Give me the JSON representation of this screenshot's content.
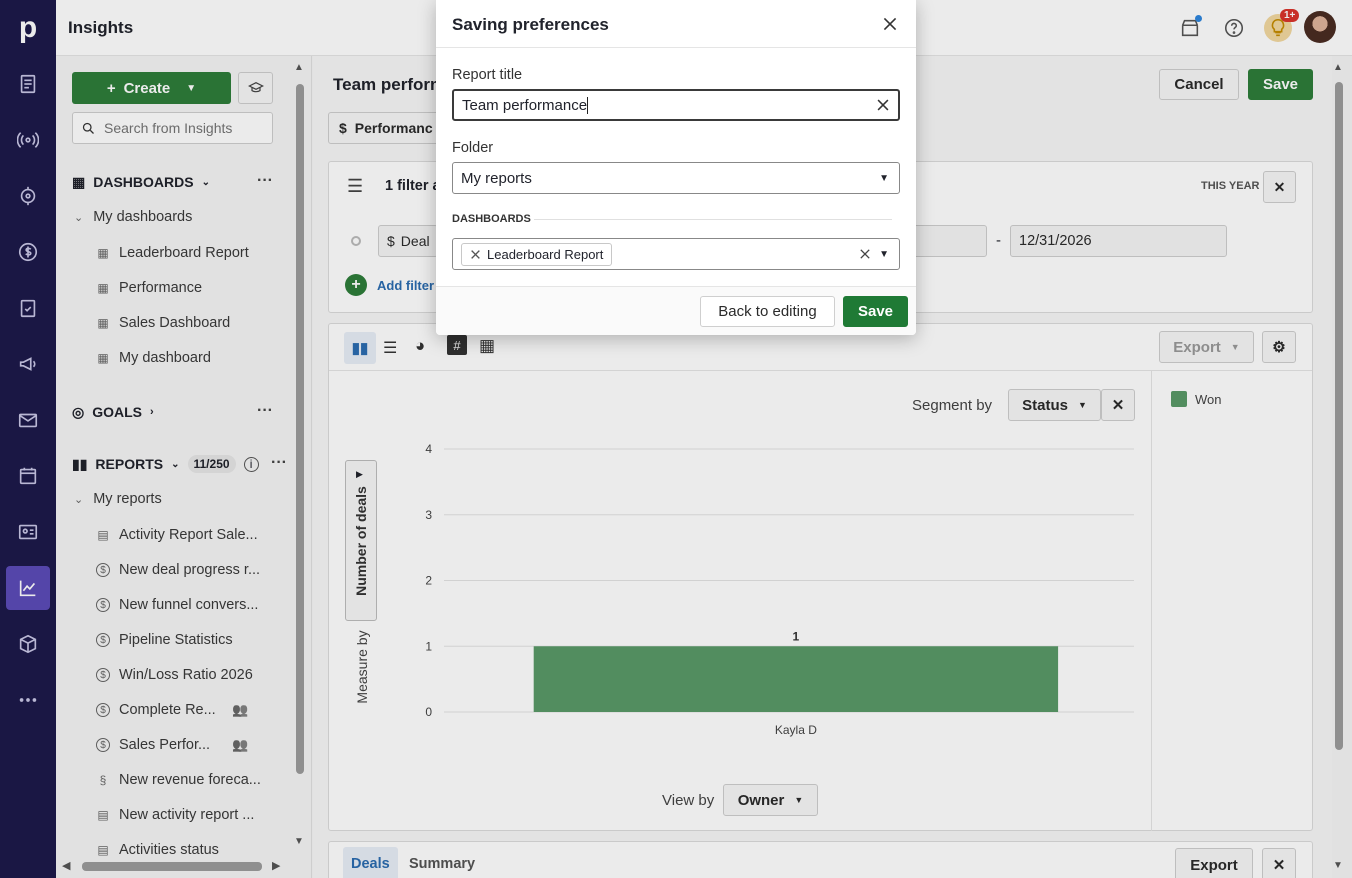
{
  "app": {
    "title": "Insights"
  },
  "topbar": {
    "notification_count": "1+"
  },
  "sidebar": {
    "create_label": "Create",
    "search_placeholder": "Search from Insights",
    "dashboards_header": "DASHBOARDS",
    "dashboards_folder": "My dashboards",
    "dashboards": [
      "Leaderboard Report",
      "Performance",
      "Sales Dashboard",
      "My dashboard"
    ],
    "goals_header": "GOALS",
    "reports_header": "REPORTS",
    "reports_count": "11/250",
    "reports_folder": "My reports",
    "reports": [
      {
        "label": "Activity Report Sale...",
        "icon": "calendar-icon"
      },
      {
        "label": "New deal progress r...",
        "icon": "dollar-icon"
      },
      {
        "label": "New funnel convers...",
        "icon": "dollar-icon"
      },
      {
        "label": "Pipeline Statistics",
        "icon": "dollar-icon"
      },
      {
        "label": "Win/Loss Ratio 2026",
        "icon": "dollar-icon"
      },
      {
        "label": "Complete Re...",
        "icon": "dollar-icon",
        "shared": true
      },
      {
        "label": "Sales Perfor...",
        "icon": "dollar-icon",
        "shared": true
      },
      {
        "label": "New revenue foreca...",
        "icon": "revenue-icon"
      },
      {
        "label": "New activity report ...",
        "icon": "calendar-icon"
      },
      {
        "label": "Activities status",
        "icon": "calendar-icon"
      }
    ]
  },
  "main": {
    "report_title": "Team perform",
    "cancel_label": "Cancel",
    "save_label": "Save",
    "entity_pill": "Performanc",
    "filter_text": "1 filter a",
    "period_label": "THIS YEAR",
    "filter_entity": "Deal",
    "date_separator": "-",
    "date_to": "12/31/2026",
    "add_filter_label": "Add filter",
    "export_label": "Export",
    "segment_label": "Segment by",
    "segment_value": "Status",
    "measure_label": "Measure by",
    "measure_value": "Number of deals",
    "view_label": "View by",
    "view_value": "Owner",
    "tabs": [
      "Deals",
      "Summary"
    ],
    "bottom_export_label": "Export"
  },
  "chart_data": {
    "type": "bar",
    "categories": [
      "Kayla D"
    ],
    "series": [
      {
        "name": "Won",
        "values": [
          1
        ],
        "color": "#5a9a68"
      }
    ],
    "ylim": [
      0,
      4
    ],
    "yticks": [
      0,
      1,
      2,
      3,
      4
    ],
    "data_labels": [
      "1"
    ],
    "ylabel": "",
    "xlabel": "",
    "legend": "right"
  },
  "modal": {
    "title": "Saving preferences",
    "report_title_label": "Report title",
    "report_title_value": "Team performance",
    "folder_label": "Folder",
    "folder_value": "My reports",
    "dashboards_label": "DASHBOARDS",
    "dashboard_chip": "Leaderboard Report",
    "back_label": "Back to editing",
    "save_label": "Save"
  },
  "colors": {
    "accent_green": "#2e7d3a",
    "rail": "#1d1a4a",
    "rail_active": "#5c4bb8",
    "bar": "#5a9a68"
  }
}
